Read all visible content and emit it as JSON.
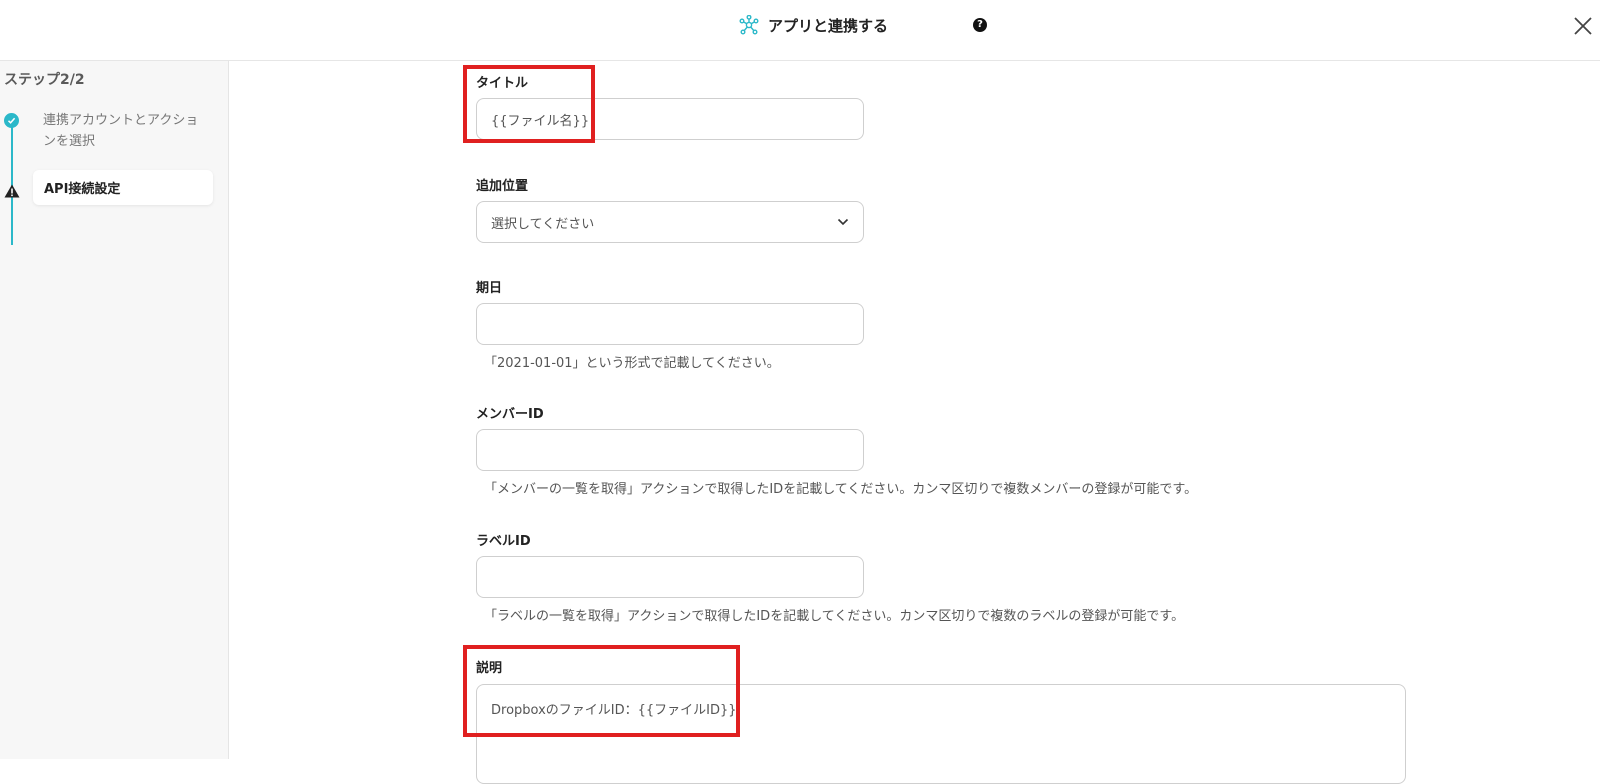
{
  "header": {
    "title": "アプリと連携する",
    "help_icon": "?",
    "close_icon": "close-icon"
  },
  "sidebar": {
    "step_counter": "ステップ2/2",
    "steps": [
      {
        "label": "連携アカウントとアクションを選択",
        "status": "completed"
      },
      {
        "label": "API接続設定",
        "status": "warning",
        "active": true
      }
    ]
  },
  "form": {
    "title": {
      "label": "タイトル",
      "value": "{{ファイル名}}"
    },
    "position": {
      "label": "追加位置",
      "selected": "選択してください"
    },
    "due_date": {
      "label": "期日",
      "value": "",
      "help": "「2021-01-01」という形式で記載してください。"
    },
    "member_id": {
      "label": "メンバーID",
      "value": "",
      "help": "「メンバーの一覧を取得」アクションで取得したIDを記載してください。カンマ区切りで複数メンバーの登録が可能です。"
    },
    "label_id": {
      "label": "ラベルID",
      "value": "",
      "help": "「ラベルの一覧を取得」アクションで取得したIDを記載してください。カンマ区切りで複数のラベルの登録が可能です。"
    },
    "description": {
      "label": "説明",
      "value": "DropboxのファイルID：{{ファイルID}}"
    }
  },
  "colors": {
    "accent": "#2bb8c9",
    "highlight": "#e02020",
    "sidebar_bg": "#f7f7f7"
  }
}
